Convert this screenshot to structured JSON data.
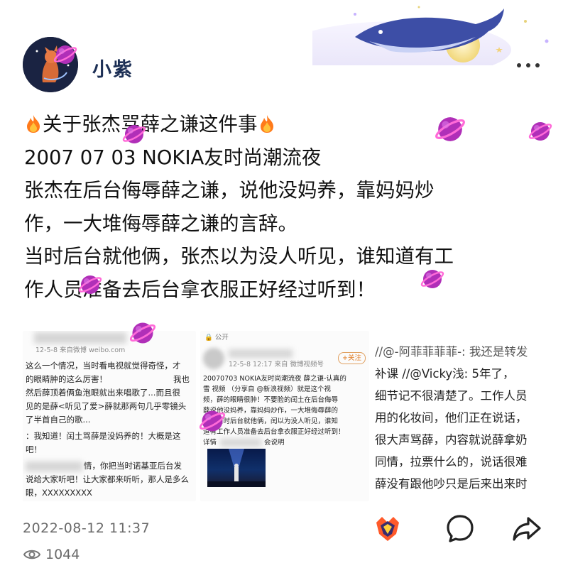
{
  "header": {
    "username": "小紫"
  },
  "post": {
    "lines": [
      "关于张杰骂薛之谦这件事",
      "2007 07 03 NOKIA友时尚潮流夜",
      "张杰在后台侮辱薛之谦，说他没妈养，靠妈妈炒",
      "作，一大堆侮辱薛之谦的言辞。",
      "当时后台就他俩，张杰以为没人听见，谁知道有工",
      "作人员准备去后台拿衣服正好经过听到！"
    ]
  },
  "images": {
    "img1": {
      "meta": "12-5-8  来自微博 weibo.com",
      "lines": [
        "这么一个情况，当时看电视就觉得奇怪，才",
        "的眼睛肿的这么厉害！",
        "然后薛顶着俩鱼泡眼就出来唱歌了...而且很",
        "见的是薛<听见了爱>薛就那两句几乎零镜头",
        "了半首自己的歌...",
        "：我知道！闰土骂薛是没妈养的！大概是这",
        "吧！",
        "情，你把当时诺基亚后台发",
        "说给大家听吧！让大家都来听听，那人是多么",
        "眼，XXXXXXXXX"
      ],
      "fragments": [
        "我也"
      ]
    },
    "img2": {
      "top": "公开",
      "follow": "+关注",
      "meta": "12-5-8 12:17  来自 微博视频号",
      "lines": [
        "20070703 NOKIA友时尚潮流夜 薛之谦-认真的",
        "雪  视频 （分享自 @新浪视频）就是这个视",
        "频，薛的眼睛很肿！不要脸的闰土在后台侮辱",
        "薛说他没妈养，靠妈妈炒作，一大堆侮辱薛的",
        "话，当时后台就他俩，闰以为没人听见，谁知",
        "道有工作人员准备去后台拿衣服正好经过听到！",
        "详情",
        "会说明"
      ]
    },
    "img3": {
      "lines": [
        "//@-阿菲菲菲菲-: 我还是转发",
        "补课  //@Vicky浅: 5年了，",
        "细节记不很清楚了。工作人员",
        "用的化妆间，他们正在说话，",
        "很大声骂薛，内容就说薛拿奶",
        "同情，拉票什么的，说话很难",
        "薛没有跟他吵只是后来出来时"
      ]
    }
  },
  "footer": {
    "timestamp": "2022-08-12 11:37",
    "views": "1044"
  }
}
